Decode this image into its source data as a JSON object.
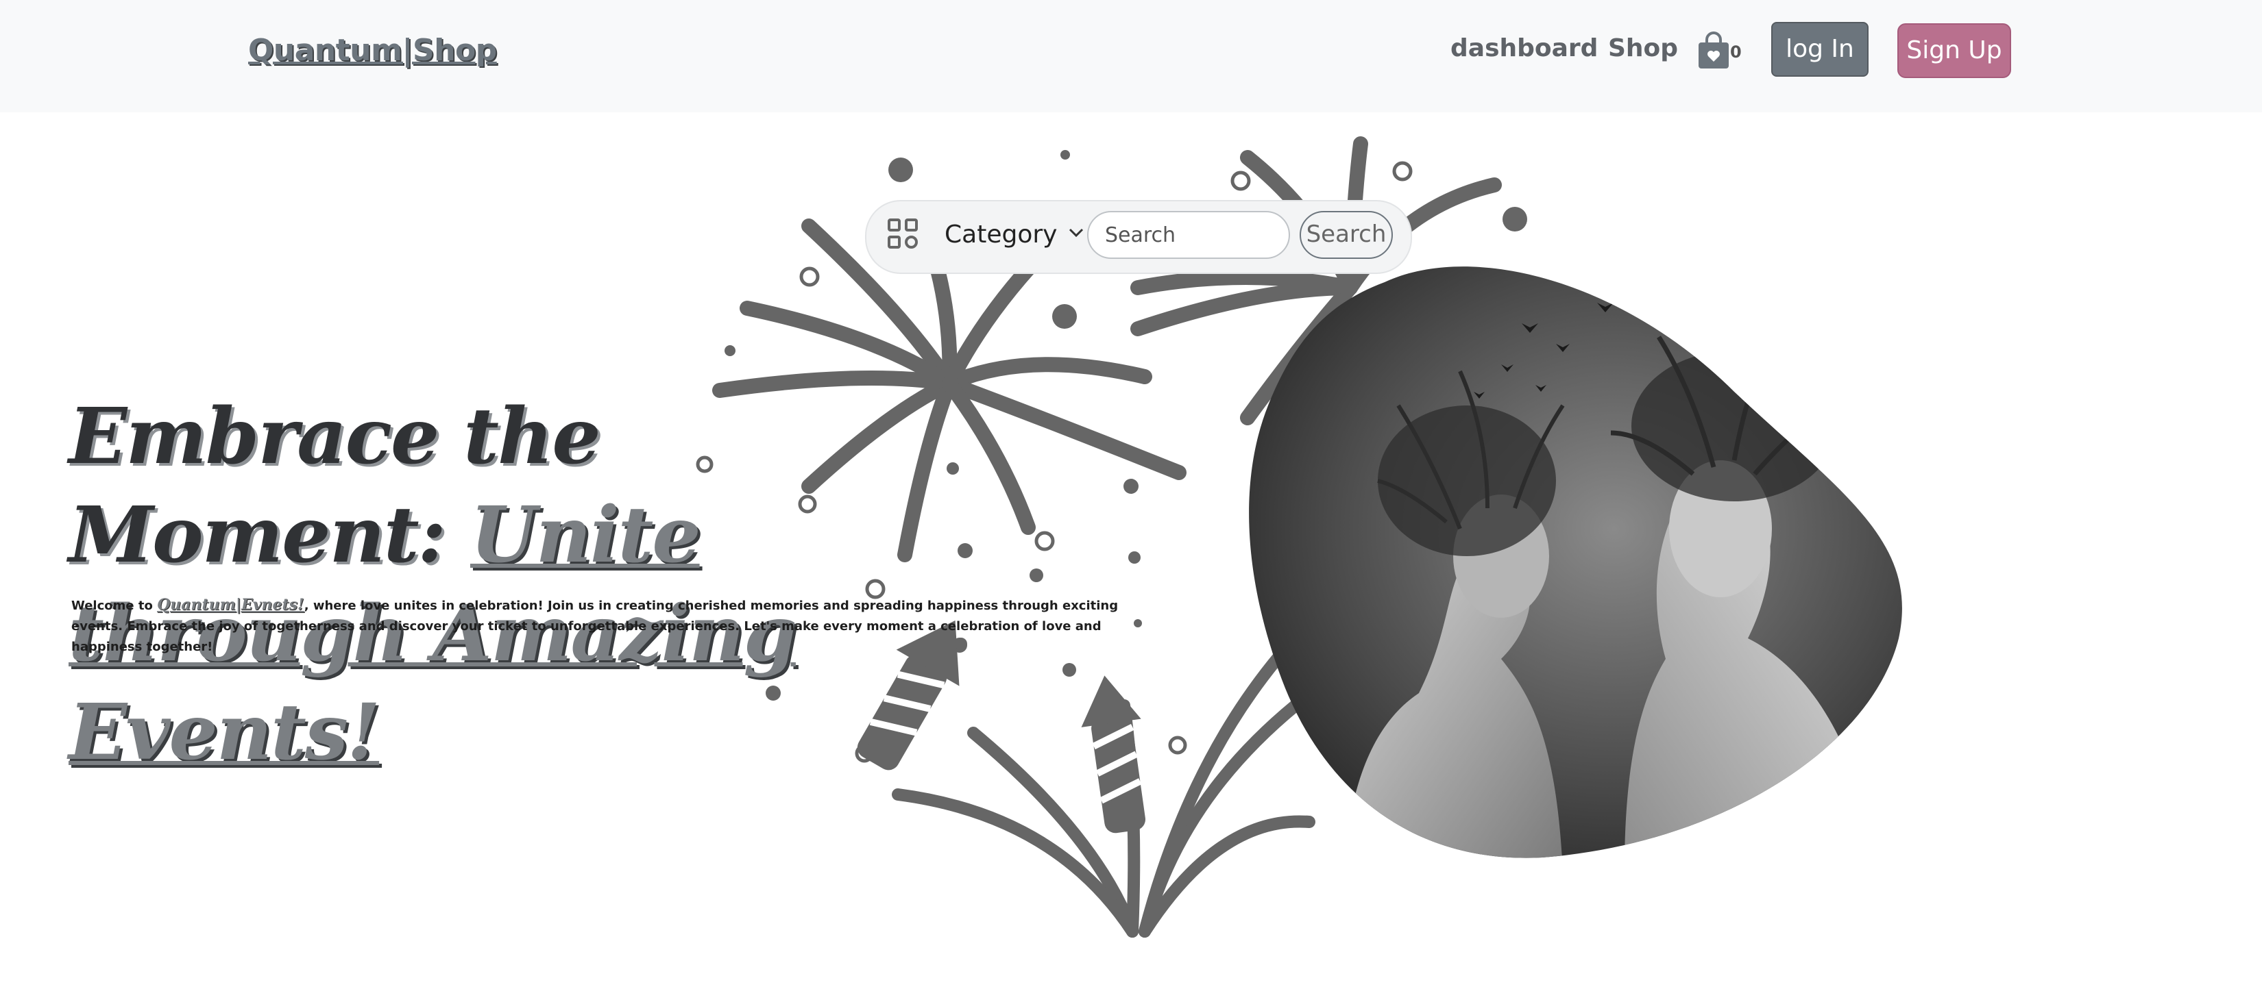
{
  "navbar": {
    "brand": "Quantum|Shop",
    "links": [
      "dashboard",
      "Shop"
    ],
    "cart_count": "0",
    "login_label": "log In",
    "signup_label": "Sign Up"
  },
  "search": {
    "category_label": "Category",
    "placeholder": "Search",
    "button_label": "Search"
  },
  "hero": {
    "title_plain": "Embrace the Moment: ",
    "title_accent": "Unite through Amazing Events!",
    "desc_prefix": "Welcome to ",
    "desc_brand": "Quantum|Evnets!",
    "desc_suffix": ", where love unites in celebration! Join us in creating cherished memories and spreading happiness through exciting events. Embrace the joy of togetherness and discover your ticket to unforgettable experiences. Let's make every moment a celebration of love and happiness together!"
  },
  "colors": {
    "navbar_bg": "#f8f9fa",
    "login_bg": "#6c757d",
    "signup_bg": "#b9708e",
    "firework": "#666666"
  },
  "icons": [
    "shopping-bag-icon",
    "grid-icon",
    "chevron-down-icon"
  ]
}
